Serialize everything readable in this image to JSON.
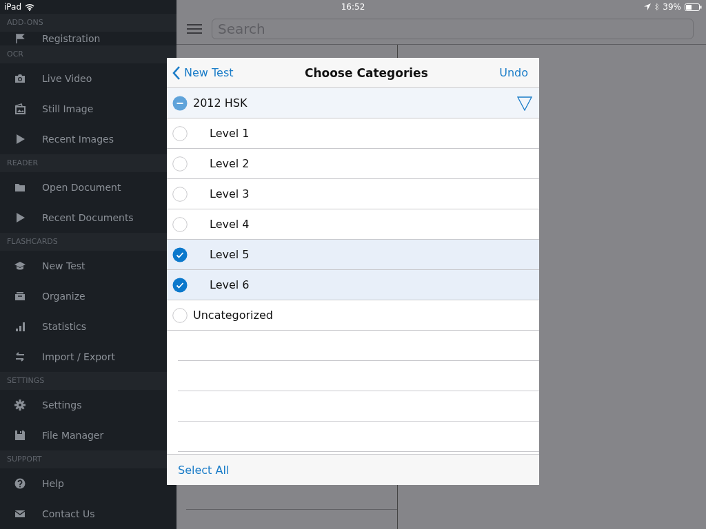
{
  "status_bar": {
    "device": "iPad",
    "time": "16:52",
    "battery": "39%"
  },
  "sidebar": {
    "sections": [
      {
        "header": "ADD-ONS",
        "items": [
          "Registration"
        ]
      },
      {
        "header": "OCR",
        "items": [
          "Live Video",
          "Still Image",
          "Recent Images"
        ]
      },
      {
        "header": "READER",
        "items": [
          "Open Document",
          "Recent Documents"
        ]
      },
      {
        "header": "FLASHCARDS",
        "items": [
          "New Test",
          "Organize",
          "Statistics",
          "Import / Export"
        ]
      },
      {
        "header": "SETTINGS",
        "items": [
          "Settings",
          "File Manager"
        ]
      },
      {
        "header": "SUPPORT",
        "items": [
          "Help",
          "Contact Us"
        ]
      }
    ]
  },
  "toolbar": {
    "search": {
      "placeholder": "Search"
    }
  },
  "popover": {
    "back": "New Test",
    "title": "Choose Categories",
    "action": "Undo",
    "categories": [
      {
        "label": "2012 HSK",
        "partial": true,
        "expanded": true,
        "children": [
          {
            "label": "Level 1",
            "checked": false
          },
          {
            "label": "Level 2",
            "checked": false
          },
          {
            "label": "Level 3",
            "checked": false
          },
          {
            "label": "Level 4",
            "checked": false
          },
          {
            "label": "Level 5",
            "checked": true
          },
          {
            "label": "Level 6",
            "checked": true
          }
        ]
      },
      {
        "label": "Uncategorized",
        "checked": false
      }
    ],
    "footer_button": "Select All"
  }
}
